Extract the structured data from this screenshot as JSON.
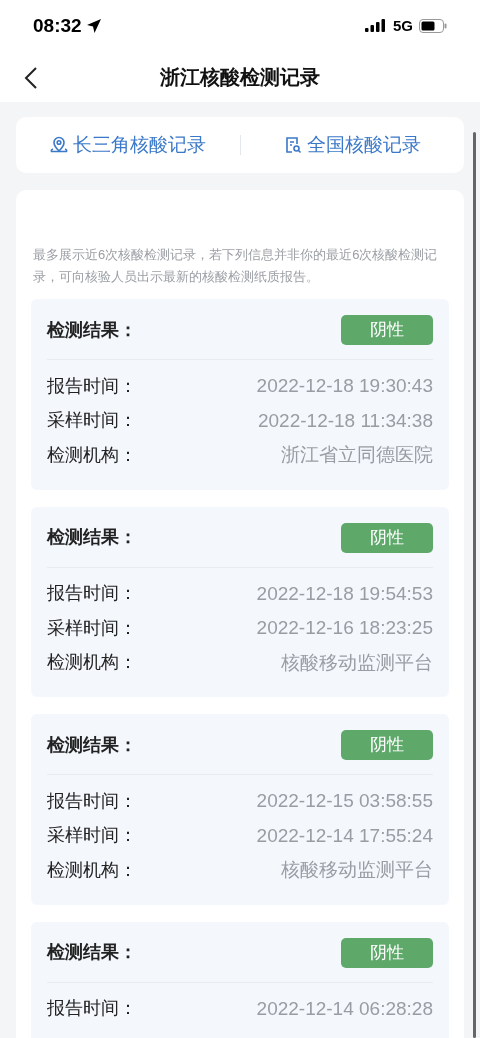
{
  "status_bar": {
    "time": "08:32",
    "network": "5G"
  },
  "header": {
    "title": "浙江核酸检测记录"
  },
  "tabs": [
    {
      "label": "长三角核酸记录",
      "kind": "location"
    },
    {
      "label": "全国核酸记录",
      "kind": "document"
    }
  ],
  "notice": "最多展示近6次核酸检测记录，若下列信息并非你的最近6次核酸检测记录，可向核验人员出示最新的核酸检测纸质报告。",
  "records": [
    {
      "result_label": "检测结果：",
      "result": "阴性",
      "fields": [
        {
          "label": "报告时间：",
          "value": "2022-12-18 19:30:43"
        },
        {
          "label": "采样时间：",
          "value": "2022-12-18 11:34:38"
        },
        {
          "label": "检测机构：",
          "value": "浙江省立同德医院"
        }
      ]
    },
    {
      "result_label": "检测结果：",
      "result": "阴性",
      "fields": [
        {
          "label": "报告时间：",
          "value": "2022-12-18 19:54:53"
        },
        {
          "label": "采样时间：",
          "value": "2022-12-16 18:23:25"
        },
        {
          "label": "检测机构：",
          "value": "核酸移动监测平台"
        }
      ]
    },
    {
      "result_label": "检测结果：",
      "result": "阴性",
      "fields": [
        {
          "label": "报告时间：",
          "value": "2022-12-15 03:58:55"
        },
        {
          "label": "采样时间：",
          "value": "2022-12-14 17:55:24"
        },
        {
          "label": "检测机构：",
          "value": "核酸移动监测平台"
        }
      ]
    },
    {
      "result_label": "检测结果：",
      "result": "阴性",
      "fields": [
        {
          "label": "报告时间：",
          "value": "2022-12-14 06:28:28"
        }
      ]
    }
  ]
}
